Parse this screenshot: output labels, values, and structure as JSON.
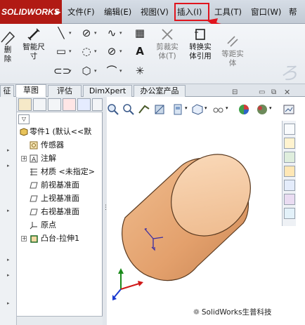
{
  "menubar": {
    "logo": "SOLIDWORKS",
    "items": [
      "文件(F)",
      "编辑(E)",
      "视图(V)",
      "插入(I)",
      "工具(T)",
      "窗口(W)",
      "帮"
    ]
  },
  "command_manager": {
    "left_label_1": "删",
    "left_label_2": "除",
    "smart_dim": "智能尺",
    "smart_dim_2": "寸",
    "trim_1": "剪裁实",
    "trim_2": "体(T)",
    "convert_1": "转换实",
    "convert_2": "体引用",
    "offset_1": "等距实",
    "offset_2": "体",
    "cursive": "ろ"
  },
  "tabs": [
    "征",
    "草图",
    "评估",
    "DimXpert",
    "办公室产品"
  ],
  "tree": {
    "items": [
      {
        "label": "零件1 (默认<<默"
      },
      {
        "label": "传感器"
      },
      {
        "label": "注解"
      },
      {
        "label": "材质 <未指定>"
      },
      {
        "label": "前视基准面"
      },
      {
        "label": "上视基准面"
      },
      {
        "label": "右视基准面"
      },
      {
        "label": "原点"
      },
      {
        "label": "凸台-拉伸1"
      }
    ]
  },
  "watermark": "SolidWorks生普科技",
  "colors": {
    "highlight": "#e0141d",
    "logo_bg": "#b11a14",
    "cylinder_face": "#f4cba6",
    "cylinder_side": "#e8a772"
  }
}
